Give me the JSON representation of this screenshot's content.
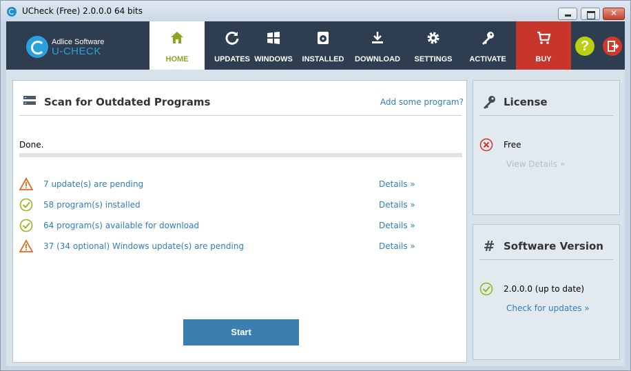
{
  "window": {
    "title": "UCheck (Free) 2.0.0.0 64 bits"
  },
  "brand": {
    "company": "Adlice Software",
    "product": "U-CHECK"
  },
  "nav": [
    {
      "label": "HOME",
      "icon": "home-icon",
      "active": true
    },
    {
      "label": "UPDATES",
      "icon": "refresh-icon"
    },
    {
      "label": "WINDOWS",
      "icon": "windows-icon"
    },
    {
      "label": "INSTALLED",
      "icon": "disk-icon"
    },
    {
      "label": "DOWNLOAD",
      "icon": "download-icon"
    },
    {
      "label": "SETTINGS",
      "icon": "gear-icon"
    },
    {
      "label": "ACTIVATE",
      "icon": "key-icon"
    },
    {
      "label": "BUY",
      "icon": "cart-icon"
    }
  ],
  "help_label": "?",
  "main": {
    "title": "Scan for Outdated Programs",
    "add_link": "Add some program?",
    "status": "Done.",
    "progress": 1.0,
    "results": [
      {
        "icon": "warning-icon",
        "text": "7 update(s) are pending",
        "link": "Details »"
      },
      {
        "icon": "check-icon",
        "text": "58 program(s) installed",
        "link": "Details »"
      },
      {
        "icon": "check-icon",
        "text": "64 program(s) available for download",
        "link": "Details »"
      },
      {
        "icon": "warning-icon",
        "text": "37 (34 optional) Windows update(s) are pending",
        "link": "Details »"
      }
    ],
    "start_label": "Start"
  },
  "license": {
    "title": "License",
    "status": "Free",
    "link": "View Details »"
  },
  "version": {
    "title": "Software Version",
    "status": "2.0.0.0 (up to date)",
    "link": "Check for updates »"
  },
  "colors": {
    "nav_bg": "#2e3d4f",
    "accent_green": "#8aa61c",
    "buy_red": "#c8352b",
    "link_blue": "#2f7fbd",
    "warning_orange": "#e06a1a"
  }
}
